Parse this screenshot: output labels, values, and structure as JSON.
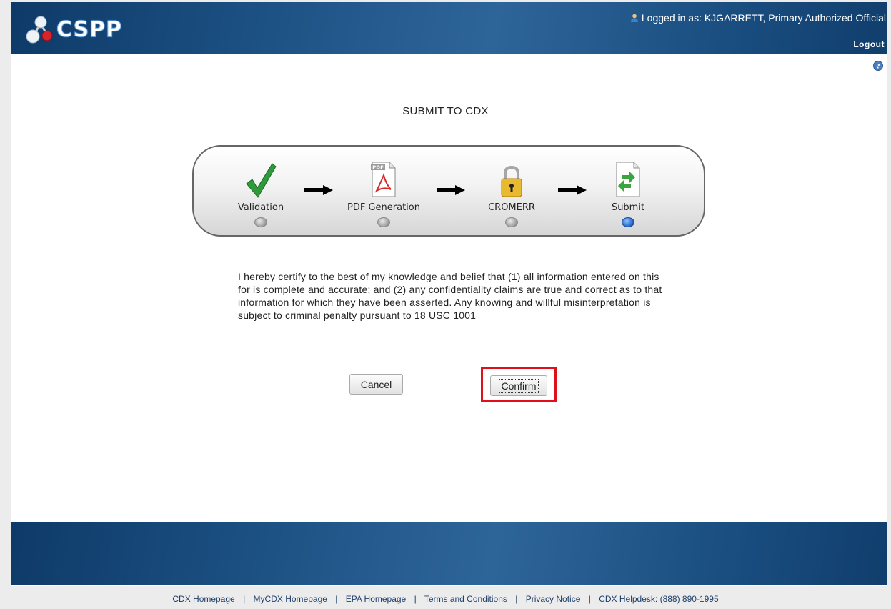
{
  "header": {
    "logo_text": "CSPP",
    "login_text": "Logged in as: KJGARRETT, Primary Authorized Official",
    "logout_label": "Logout"
  },
  "main": {
    "title": "SUBMIT TO CDX",
    "steps": [
      {
        "label": "Validation",
        "icon": "checkmark-icon",
        "active": false
      },
      {
        "label": "PDF Generation",
        "icon": "pdf-icon",
        "active": false
      },
      {
        "label": "CROMERR",
        "icon": "lock-icon",
        "active": false
      },
      {
        "label": "Submit",
        "icon": "submit-document-icon",
        "active": true
      }
    ],
    "pdf_badge": "PDF",
    "certification": "I hereby certify to the best of my knowledge and belief that (1) all information entered on this for is complete and accurate; and (2) any confidentiality claims are true and correct as to that information for which they have been asserted. Any knowing and willful misinterpretation is subject to criminal penalty pursuant to 18 USC 1001",
    "cancel_label": "Cancel",
    "confirm_label": "Confirm"
  },
  "footer": {
    "links": [
      "CDX Homepage",
      "MyCDX Homepage",
      "EPA Homepage",
      "Terms and Conditions",
      "Privacy Notice",
      "CDX Helpdesk: (888) 890-1995"
    ],
    "separator": "|"
  },
  "colors": {
    "header_blue": "#1d5285",
    "highlight_red": "#e0101a",
    "active_dot": "#1f5fc4"
  }
}
